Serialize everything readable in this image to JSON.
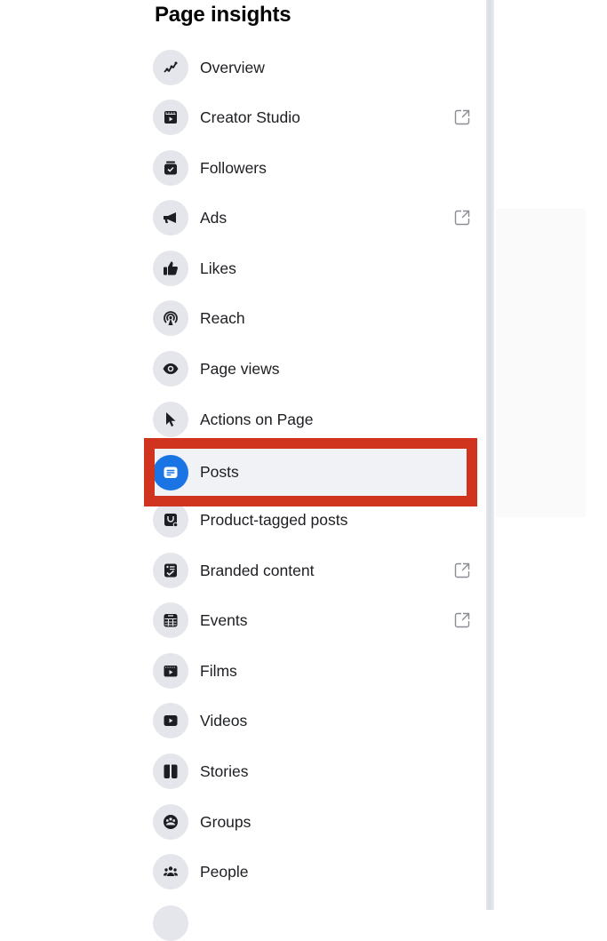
{
  "sidebar": {
    "title": "Page insights",
    "items": [
      {
        "label": "Overview",
        "icon": "trend-line-icon",
        "external": false,
        "selected": false
      },
      {
        "label": "Creator Studio",
        "icon": "clapperboard-icon",
        "external": true,
        "selected": false
      },
      {
        "label": "Followers",
        "icon": "inbox-check-icon",
        "external": false,
        "selected": false
      },
      {
        "label": "Ads",
        "icon": "megaphone-icon",
        "external": true,
        "selected": false
      },
      {
        "label": "Likes",
        "icon": "thumbs-up-icon",
        "external": false,
        "selected": false
      },
      {
        "label": "Reach",
        "icon": "broadcast-icon",
        "external": false,
        "selected": false
      },
      {
        "label": "Page views",
        "icon": "eye-icon",
        "external": false,
        "selected": false
      },
      {
        "label": "Actions on Page",
        "icon": "cursor-icon",
        "external": false,
        "selected": false
      },
      {
        "label": "Posts",
        "icon": "post-icon",
        "external": false,
        "selected": true
      },
      {
        "label": "Product-tagged posts",
        "icon": "shopping-tag-icon",
        "external": false,
        "selected": false
      },
      {
        "label": "Branded content",
        "icon": "checklist-icon",
        "external": true,
        "selected": false
      },
      {
        "label": "Events",
        "icon": "calendar-icon",
        "external": true,
        "selected": false
      },
      {
        "label": "Films",
        "icon": "film-icon",
        "external": false,
        "selected": false
      },
      {
        "label": "Videos",
        "icon": "play-icon",
        "external": false,
        "selected": false
      },
      {
        "label": "Stories",
        "icon": "book-icon",
        "external": false,
        "selected": false
      },
      {
        "label": "Groups",
        "icon": "groups-icon",
        "external": false,
        "selected": false
      },
      {
        "label": "People",
        "icon": "people-icon",
        "external": false,
        "selected": false
      }
    ]
  },
  "colors": {
    "accent": "#1b74e4",
    "highlight_border": "#d0341f",
    "selected_bg": "#f0f2f5",
    "icon_bg": "#e4e6eb"
  }
}
